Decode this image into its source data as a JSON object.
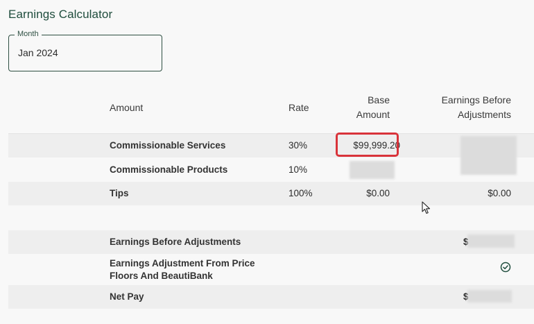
{
  "page": {
    "title": "Earnings Calculator"
  },
  "month_field": {
    "legend": "Month",
    "value": "Jan 2024"
  },
  "table": {
    "headers": {
      "amount": "Amount",
      "rate": "Rate",
      "base_amount_line1": "Base",
      "base_amount_line2": "Amount",
      "earnings_line1": "Earnings Before",
      "earnings_line2": "Adjustments"
    },
    "rows": [
      {
        "label": "Commissionable Services",
        "rate": "30%",
        "base": "$99,999.20",
        "earnings": ""
      },
      {
        "label": "Commissionable Products",
        "rate": "10%",
        "base": "",
        "earnings": ""
      },
      {
        "label": "Tips",
        "rate": "100%",
        "base": "$0.00",
        "earnings": "$0.00"
      }
    ]
  },
  "summary": {
    "rows": [
      {
        "label": "Earnings Before Adjustments",
        "value_prefix": "$"
      },
      {
        "label_line1": "Earnings Adjustment From Price",
        "label_line2": "Floors And BeautiBank"
      },
      {
        "label": "Net Pay",
        "value_prefix": "$"
      }
    ]
  },
  "colors": {
    "accent": "#1f4d3d",
    "highlight": "#d9333a",
    "row_shade": "#eeeeee"
  }
}
